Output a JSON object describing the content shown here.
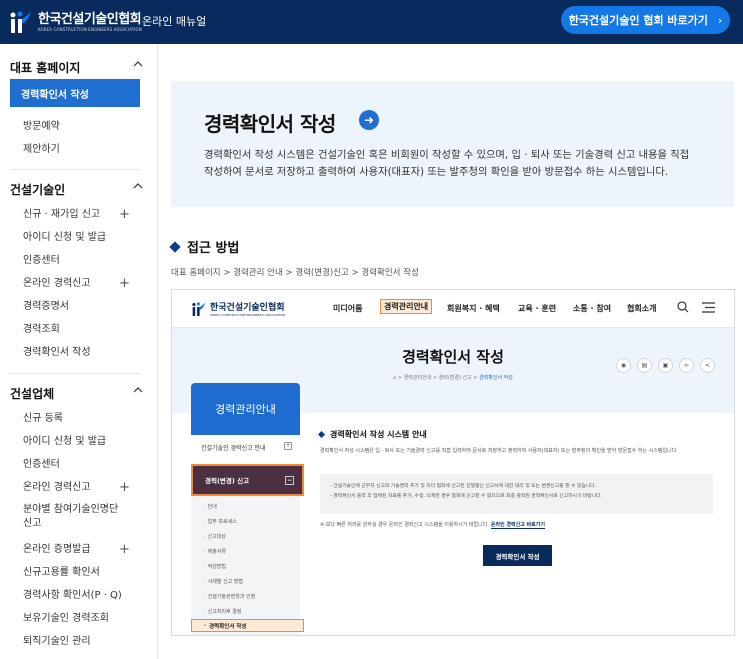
{
  "header": {
    "logo_main": "한국건설기술인협회",
    "logo_sub": "KOREA CONSTRUCTION ENGINEERS ASSOCIATION",
    "manual_label": "온라인 매뉴얼",
    "home_button": "한국건설기술인 협회 바로가기",
    "colors": {
      "bar": "#082a5c",
      "button": "#1479e6"
    }
  },
  "sidebar": {
    "sections": [
      {
        "title": "대표 홈페이지",
        "active_item": "경력확인서 작성",
        "items": [
          {
            "label": "방문예약",
            "plus": ""
          },
          {
            "label": "제안하기",
            "plus": ""
          }
        ]
      },
      {
        "title": "건설기술인",
        "items": [
          {
            "label": "신규 · 재가입 신고",
            "plus": "+"
          },
          {
            "label": "아이디 신청 및 발급",
            "plus": ""
          },
          {
            "label": "인증센터",
            "plus": ""
          },
          {
            "label": "온라인 경력신고",
            "plus": "+"
          },
          {
            "label": "경력증명서",
            "plus": ""
          },
          {
            "label": "경력조회",
            "plus": ""
          },
          {
            "label": "경력확인서 작성",
            "plus": ""
          }
        ]
      },
      {
        "title": "건설업체",
        "items": [
          {
            "label": "신규 등록",
            "plus": ""
          },
          {
            "label": "아이디 신청 및 발급",
            "plus": ""
          },
          {
            "label": "인증센터",
            "plus": ""
          },
          {
            "label": "온라인 경력신고",
            "plus": "+"
          },
          {
            "label": "분야별 참여기술인명단",
            "label2": "신고",
            "plus": ""
          },
          {
            "label": "온라인 증명발급",
            "plus": "+"
          },
          {
            "label": "신규고용률 확인서",
            "plus": ""
          },
          {
            "label": "경력사항 확인서(P · Q)",
            "plus": ""
          },
          {
            "label": "보유기술인 경력조회",
            "plus": ""
          },
          {
            "label": "퇴직기술인 관리",
            "plus": ""
          }
        ]
      }
    ],
    "active_color": "#1f6fd1"
  },
  "banner": {
    "title": "경력확인서 작성",
    "arrow_icon": "arrow-right-icon",
    "desc_line1": "경력확인서 작성 시스템은 건설기술인 혹은 비회원이 작성할 수 있으며, 입 · 퇴사 또는 기술경력 신고 내용을 직접",
    "desc_line2": "작성하여 문서로 저장하고 출력하여 사용자(대표자) 또는 발주청의 확인을 받아 방문접수 하는 시스템입니다."
  },
  "section": {
    "title": "접근 방법",
    "breadcrumb": "대표 홈페이지 > 경력관리 안내 > 경력(변경)신고 > 경력확인서 작성"
  },
  "screenshot": {
    "logo_main": "한국건설기술인협회",
    "logo_sub": "KOREA CONSTRUCTION ENGINEERS ASSOCIATION",
    "menu": [
      "미디어룸",
      "경력관리안내",
      "회원복지 · 혜택",
      "교육 · 훈련",
      "소통 · 참여",
      "협회소개"
    ],
    "hero_title": "경력확인서 작성",
    "hero_crumb": "⌂ > 경력관리안내 > 경력(변경) 신고 > ",
    "hero_crumb_current": "경력확인서 작성",
    "side_title": "경력관리안내",
    "side_row1": "건설기술인 경력신고 안내",
    "side_dark": "경력(변경) 신고",
    "side_subs": [
      "안내",
      "업무 프로세스",
      "신고대상",
      "제출서류",
      "작성방법",
      "사례별 신고 방법",
      "건설기술관련학과 인정",
      "신고처리후 결정"
    ],
    "side_selected": "경력확인서 작성",
    "content_title": "경력확인서 작성 시스템 안내",
    "content_p": "경력확인서 작성 시스템은 입 · 퇴사 또는 기술경력 신고를 직접 입력하여 문서로 저장하고 출력하여 사용자(대표자) 또는 발주청의 확인을 받아 방문접수 하는 시스템입니다.",
    "box_line1": "- 건설기술인에 근무처 신고와 기술경력 추가 및 미더 협회에 신고된 진행중인 신고서에 대한 대리 및 또는 변경신고를 할 수 있습니다.",
    "box_line2": "- 경력확인서 출력 후 업체된 자료를 추가, 수정, 삭제한 경우 협회에 신고할 수 없으므로 최종 출력된 경력확인서로 신고하시기 바랍니다.",
    "note": "※ 보다 빠른 처리를 원하실 경우 온라인 경력신고 시스템을 이용하시기 바랍니다.",
    "note_link": "온라인 경력신고 바로가기",
    "button": "경력확인서 작성"
  }
}
